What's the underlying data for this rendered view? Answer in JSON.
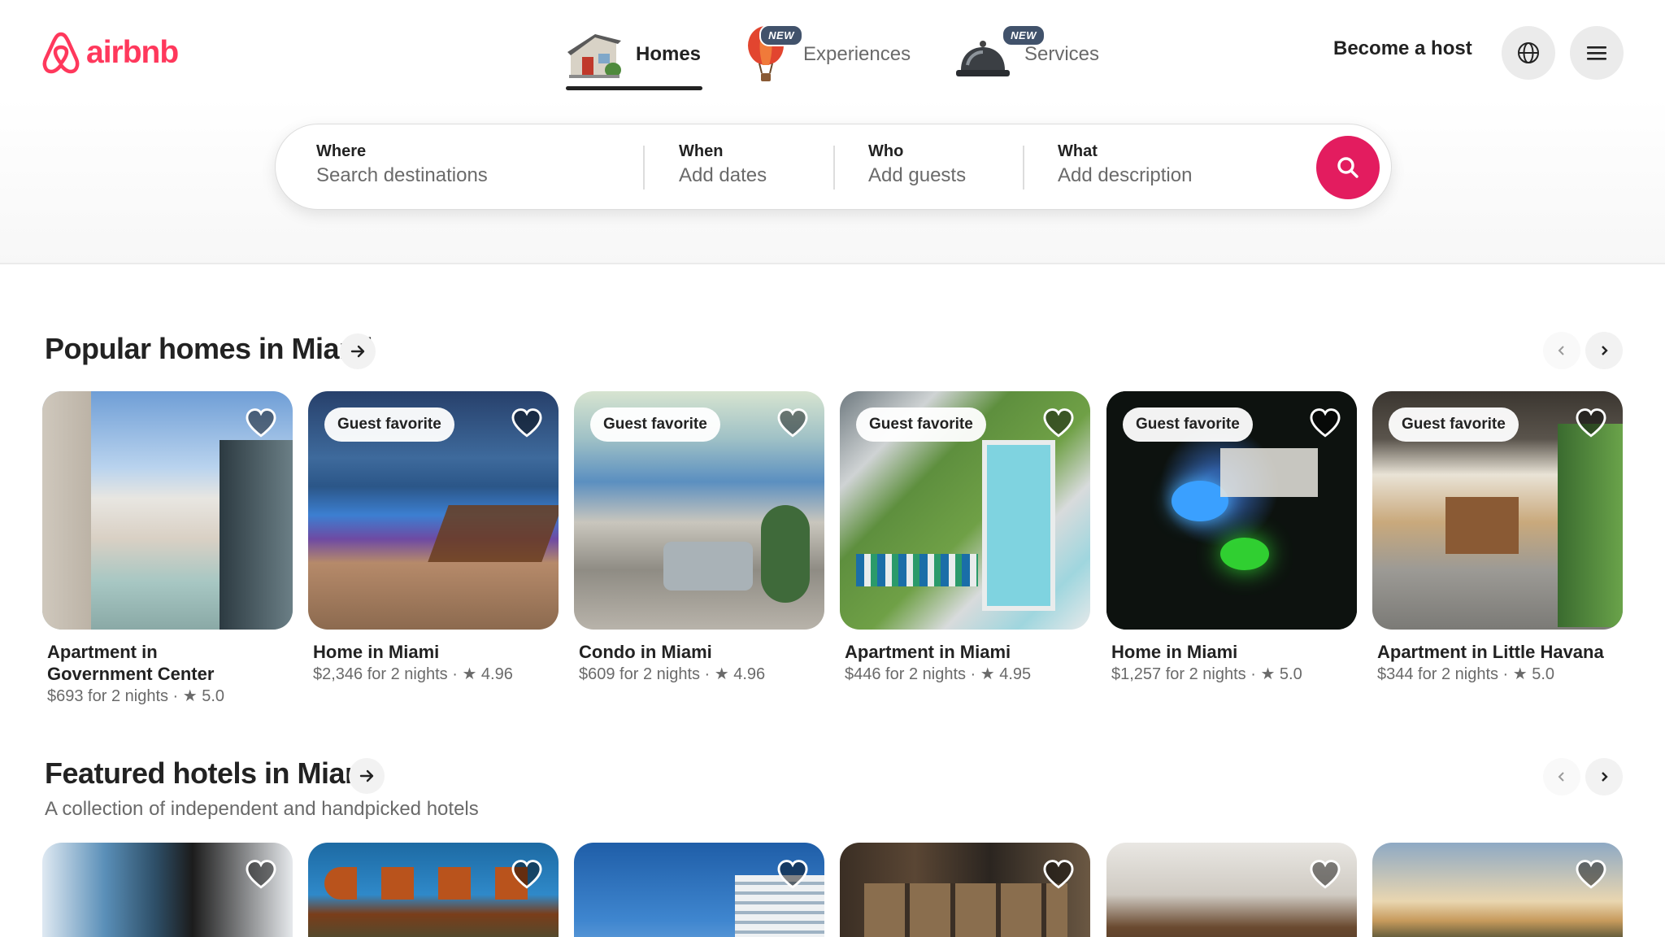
{
  "brand": {
    "name": "airbnb",
    "color": "#FF385C"
  },
  "nav": {
    "tabs": [
      {
        "label": "Homes",
        "icon": "house-icon",
        "active": true
      },
      {
        "label": "Experiences",
        "icon": "hot-air-balloon-icon",
        "badge": "NEW"
      },
      {
        "label": "Services",
        "icon": "service-bell-icon",
        "badge": "NEW"
      }
    ],
    "become_host": "Become a host",
    "globe_icon": "globe-icon",
    "menu_icon": "hamburger-menu-icon"
  },
  "search": {
    "where": {
      "label": "Where",
      "placeholder": "Search destinations"
    },
    "when": {
      "label": "When",
      "placeholder": "Add dates"
    },
    "who": {
      "label": "Who",
      "placeholder": "Add guests"
    },
    "what": {
      "label": "What",
      "placeholder": "Add description"
    },
    "button_icon": "search-icon",
    "button_color": "#E31C5F"
  },
  "popular": {
    "title": "Popular homes in Miami",
    "cards": [
      {
        "title_line1": "Apartment in",
        "title_line2": "Government Center",
        "meta": "$693 for 2 nights · ★ 5.0"
      },
      {
        "badge": "Guest favorite",
        "title_line1": "Home in Miami",
        "meta": "$2,346 for 2 nights · ★ 4.96"
      },
      {
        "badge": "Guest favorite",
        "title_line1": "Condo in Miami",
        "meta": "$609 for 2 nights · ★ 4.96"
      },
      {
        "badge": "Guest favorite",
        "title_line1": "Apartment in Miami",
        "meta": "$446 for 2 nights · ★ 4.95"
      },
      {
        "badge": "Guest favorite",
        "title_line1": "Home in Miami",
        "meta": "$1,257 for 2 nights · ★ 5.0"
      },
      {
        "badge": "Guest favorite",
        "title_line1": "Apartment in Little Havana",
        "meta": "$344 for 2 nights · ★ 5.0"
      }
    ]
  },
  "hotels": {
    "title": "Featured hotels in Miami",
    "subtitle": "A collection of independent and handpicked hotels"
  }
}
